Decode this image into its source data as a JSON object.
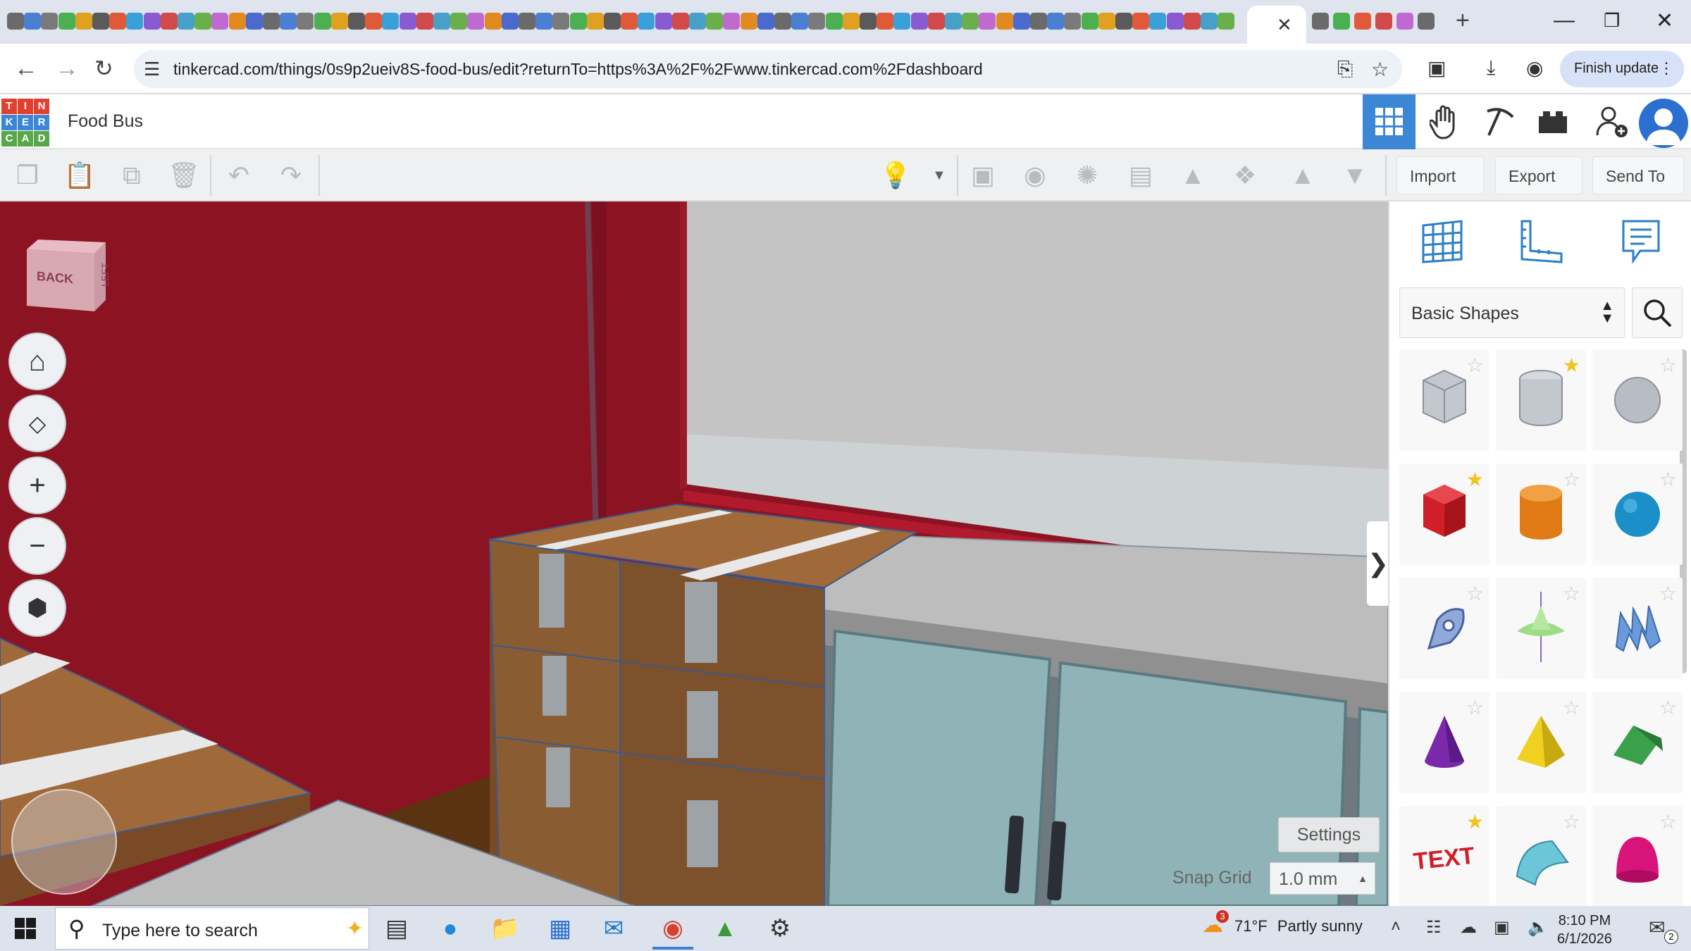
{
  "browser": {
    "active_tab_close": "✕",
    "new_tab": "+",
    "url": "tinkercad.com/things/0s9p2ueiv8S-food-bus/edit?returnTo=https%3A%2F%2Fwww.tinkercad.com%2Fdashboard",
    "finish_update_label": "Finish update",
    "tab_icon_colors": [
      "#6a6a6a",
      "#4a7fd1",
      "#7a7a7a",
      "#4bb04f",
      "#e0a020",
      "#5a5a5a",
      "#e05a3a",
      "#3aa0d8",
      "#8a5ad0",
      "#d04a4a",
      "#47a0c8",
      "#6ab04a",
      "#c06ad0",
      "#e08a20",
      "#4a6ad0"
    ]
  },
  "header": {
    "logo_letters": [
      "T",
      "I",
      "N",
      "K",
      "E",
      "R",
      "C",
      "A",
      "D"
    ],
    "logo_colors": [
      "#e2402e",
      "#e2402e",
      "#e2402e",
      "#3b87d6",
      "#3b87d6",
      "#3b87d6",
      "#58a84b",
      "#58a84b",
      "#58a84b"
    ],
    "design_title": "Food Bus",
    "accent": "#3b87d6"
  },
  "toolbar": {
    "import_label": "Import",
    "export_label": "Export",
    "send_to_label": "Send To"
  },
  "viewport": {
    "viewcube_front": "BACK",
    "viewcube_side": "LEFT",
    "settings_label": "Settings",
    "snap_grid_label": "Snap Grid",
    "snap_grid_value": "1.0 mm",
    "panel_toggle": "❯"
  },
  "panel": {
    "library_selected": "Basic Shapes",
    "shapes": [
      {
        "name": "box-hole",
        "favorite": false
      },
      {
        "name": "cylinder-hole",
        "favorite": true
      },
      {
        "name": "sphere-hole",
        "favorite": false
      },
      {
        "name": "box",
        "favorite": true
      },
      {
        "name": "cylinder",
        "favorite": false
      },
      {
        "name": "sphere",
        "favorite": false
      },
      {
        "name": "scribble",
        "favorite": false
      },
      {
        "name": "graphics",
        "favorite": false
      },
      {
        "name": "text-wave",
        "favorite": false
      },
      {
        "name": "cone",
        "favorite": false
      },
      {
        "name": "pyramid",
        "favorite": false
      },
      {
        "name": "roof",
        "favorite": false
      },
      {
        "name": "text",
        "favorite": true
      },
      {
        "name": "half-cylinder",
        "favorite": false
      },
      {
        "name": "paraboloid",
        "favorite": false
      }
    ],
    "text_shape_label": "TEXT"
  },
  "taskbar": {
    "search_placeholder": "Type here to search",
    "weather_temp": "71°F",
    "weather_desc": "Partly sunny",
    "weather_alerts": "3",
    "time": "8:10 PM",
    "date": "6/1/2026",
    "notifications": "2"
  }
}
